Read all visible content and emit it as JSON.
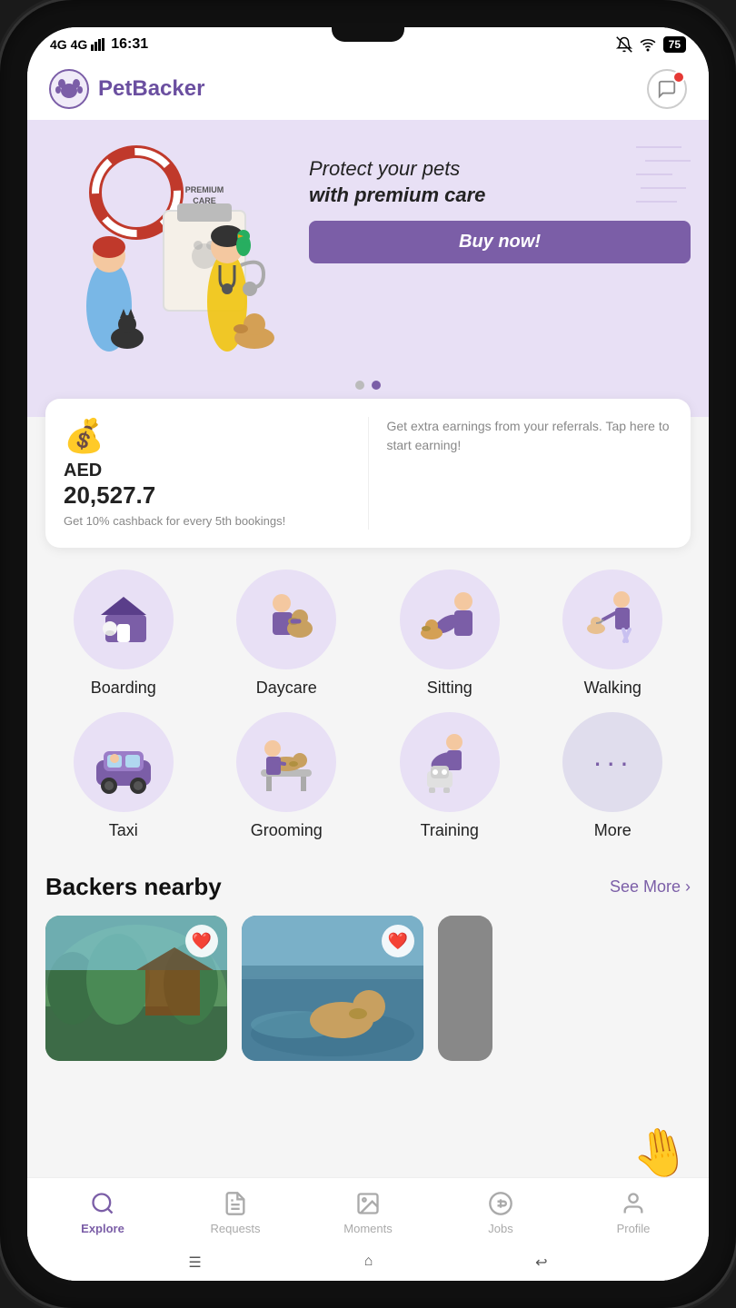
{
  "status_bar": {
    "network": "4G 4G",
    "time": "16:31",
    "battery": "75"
  },
  "header": {
    "logo_text_normal": "Pet",
    "logo_text_bold": "Backer",
    "chat_label": "Messages"
  },
  "banner": {
    "title_line1": "Protect your pets",
    "title_line2": "with premium care",
    "button_label": "Buy now!",
    "dot_active": 1,
    "dots_count": 2
  },
  "earnings": {
    "currency": "AED",
    "amount": "20,527.7",
    "cashback_note": "Get 10% cashback for every 5th bookings!",
    "referral_text": "Get extra earnings from your referrals. Tap here to start earning!"
  },
  "services": {
    "row1": [
      {
        "id": "boarding",
        "label": "Boarding"
      },
      {
        "id": "daycare",
        "label": "Daycare"
      },
      {
        "id": "sitting",
        "label": "Sitting"
      },
      {
        "id": "walking",
        "label": "Walking"
      }
    ],
    "row2": [
      {
        "id": "taxi",
        "label": "Taxi"
      },
      {
        "id": "grooming",
        "label": "Grooming"
      },
      {
        "id": "training",
        "label": "Training"
      },
      {
        "id": "more",
        "label": "More"
      }
    ]
  },
  "nearby": {
    "title": "Backers nearby",
    "see_more": "See More ›"
  },
  "bottom_nav": {
    "items": [
      {
        "id": "explore",
        "label": "Explore",
        "active": true
      },
      {
        "id": "requests",
        "label": "Requests",
        "active": false
      },
      {
        "id": "moments",
        "label": "Moments",
        "active": false
      },
      {
        "id": "jobs",
        "label": "Jobs",
        "active": false
      },
      {
        "id": "profile",
        "label": "Profile",
        "active": false
      }
    ]
  }
}
